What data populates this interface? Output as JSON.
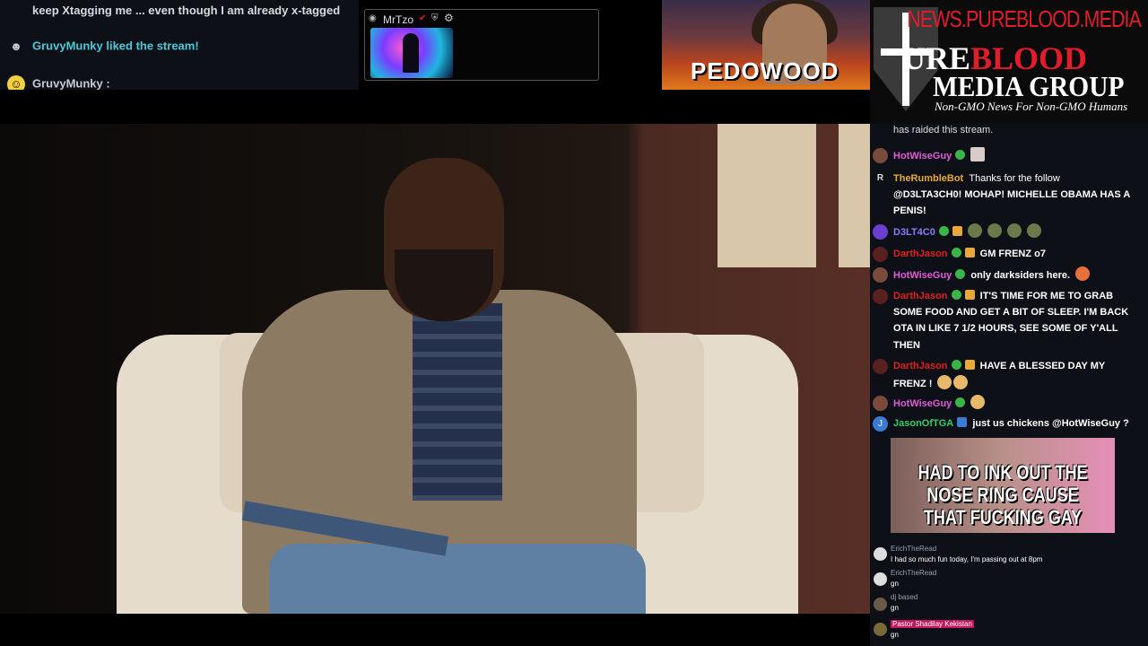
{
  "top_chat": {
    "line1": "keep Xtagging me ... even though I am already x-tagged",
    "line2_user": "GruvyMunky",
    "line2_text": "GruvyMunky liked the stream!",
    "line3_user": "GruvyMunky :"
  },
  "mini_viewer": {
    "name": "MrTzo"
  },
  "banner": {
    "text": "PEDOWOOD"
  },
  "logo": {
    "url": "NEWS.PUREBLOOD.MEDIA",
    "line1_a": "URE",
    "line1_b": "BLOOD",
    "line2": "MEDIA GROUP",
    "tagline": "Non-GMO News For Non-GMO Humans"
  },
  "chat": {
    "raid_text": "has raided this stream.",
    "messages": [
      {
        "user": "HotWiseGuy",
        "user_color": "#e05cd8",
        "text": ""
      },
      {
        "user": "TheRumbleBot",
        "user_color": "#e8a93a",
        "text": "Thanks for the follow"
      },
      {
        "user": "",
        "text": "@D3LTA3CH0! MOHAP! MICHELLE OBAMA HAS A"
      },
      {
        "user": "",
        "text": "PENIS!"
      },
      {
        "user": "D3LT4C0",
        "user_color": "#8a7cff",
        "text": ""
      },
      {
        "user": "DarthJason",
        "user_color": "#e02020",
        "text": "GM FRENZ o7"
      },
      {
        "user": "HotWiseGuy",
        "user_color": "#e05cd8",
        "text": "only darksiders here."
      },
      {
        "user": "DarthJason",
        "user_color": "#e02020",
        "text": "IT'S TIME FOR ME TO GRAB"
      },
      {
        "user": "",
        "text": "SOME FOOD AND GET A BIT OF SLEEP. I'M BACK"
      },
      {
        "user": "",
        "text": "OTA IN LIKE 7 1/2 HOURS, SEE SOME OF Y'ALL"
      },
      {
        "user": "",
        "text": "THEN"
      },
      {
        "user": "DarthJason",
        "user_color": "#e02020",
        "text": "HAVE A BLESSED DAY MY"
      },
      {
        "user": "",
        "text": "FRENZ !"
      },
      {
        "user": "HotWiseGuy",
        "user_color": "#e05cd8",
        "text": ""
      },
      {
        "user": "JasonOfTGA",
        "user_color": "#2fcf6a",
        "text": "just us chickens",
        "mention": "@HotWiseGuy ?"
      }
    ],
    "meme_text": "HAD TO INK OUT THE NOSE RING CAUSE THAT FUCKING GAY",
    "small_messages": [
      {
        "user": "ErichTheRead",
        "text": "I had so much fun today, I'm passing out at 8pm"
      },
      {
        "user": "ErichTheRead",
        "text": "gn"
      },
      {
        "user": "dj based",
        "text": "gn"
      },
      {
        "user": "Pastor Shadilay Kekistan",
        "text": "gn"
      }
    ]
  }
}
